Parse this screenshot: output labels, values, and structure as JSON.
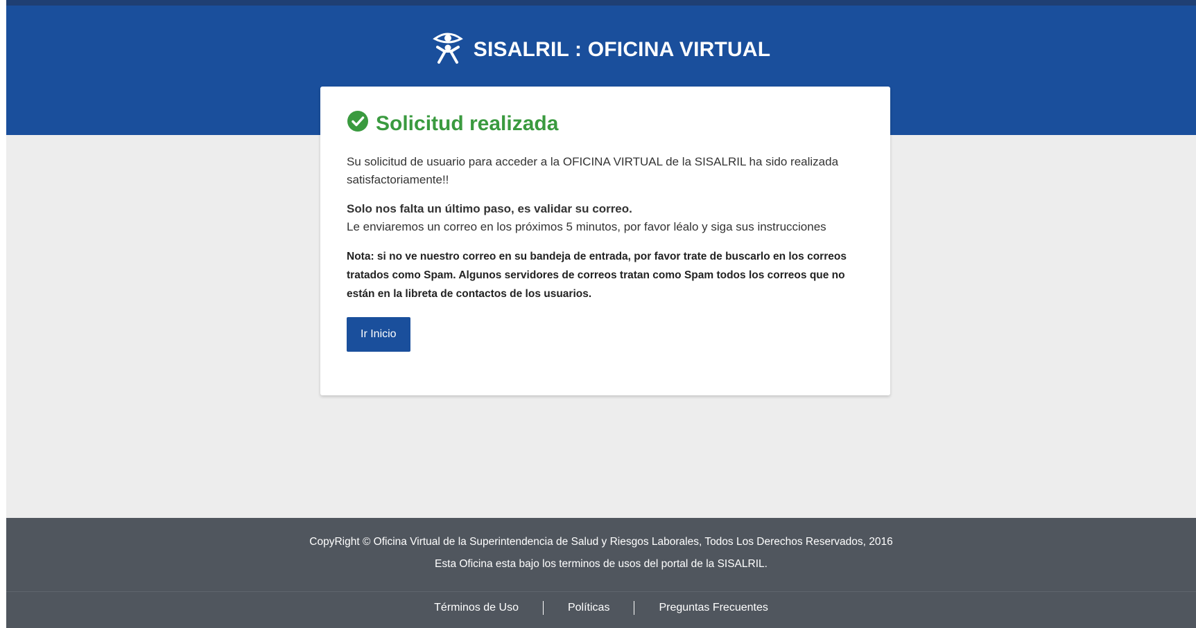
{
  "header": {
    "title": "SISALRIL : OFICINA VIRTUAL",
    "logo_icon": "eye-person-icon",
    "color": "#1a4f9c"
  },
  "card": {
    "title": "Solicitud realizada",
    "title_icon": "check-circle-icon",
    "title_color": "#3a9a3f",
    "message": "Su solicitud de usuario para acceder a la OFICINA VIRTUAL de la SISALRIL ha sido realizada satisfactoriamente!!",
    "step_bold": "Solo nos falta un último paso, es validar su correo.",
    "step_text": "Le enviaremos un correo en los próximos 5 minutos, por favor léalo y siga sus instrucciones",
    "note": "Nota: si no ve nuestro correo en su bandeja de entrada, por favor trate de buscarlo en los correos tratados como Spam. Algunos servidores de correos tratan como Spam todos los correos que no están en la libreta de contactos de los usuarios.",
    "button_label": "Ir Inicio"
  },
  "footer": {
    "copyright": "CopyRight © Oficina Virtual de la Superintendencia de Salud y Riesgos Laborales, Todos Los Derechos Reservados, 2016",
    "terms_note": "Esta Oficina esta bajo los terminos de usos del portal de la SISALRIL.",
    "links": [
      "Términos de Uso",
      "Políticas",
      "Preguntas Frecuentes"
    ]
  }
}
